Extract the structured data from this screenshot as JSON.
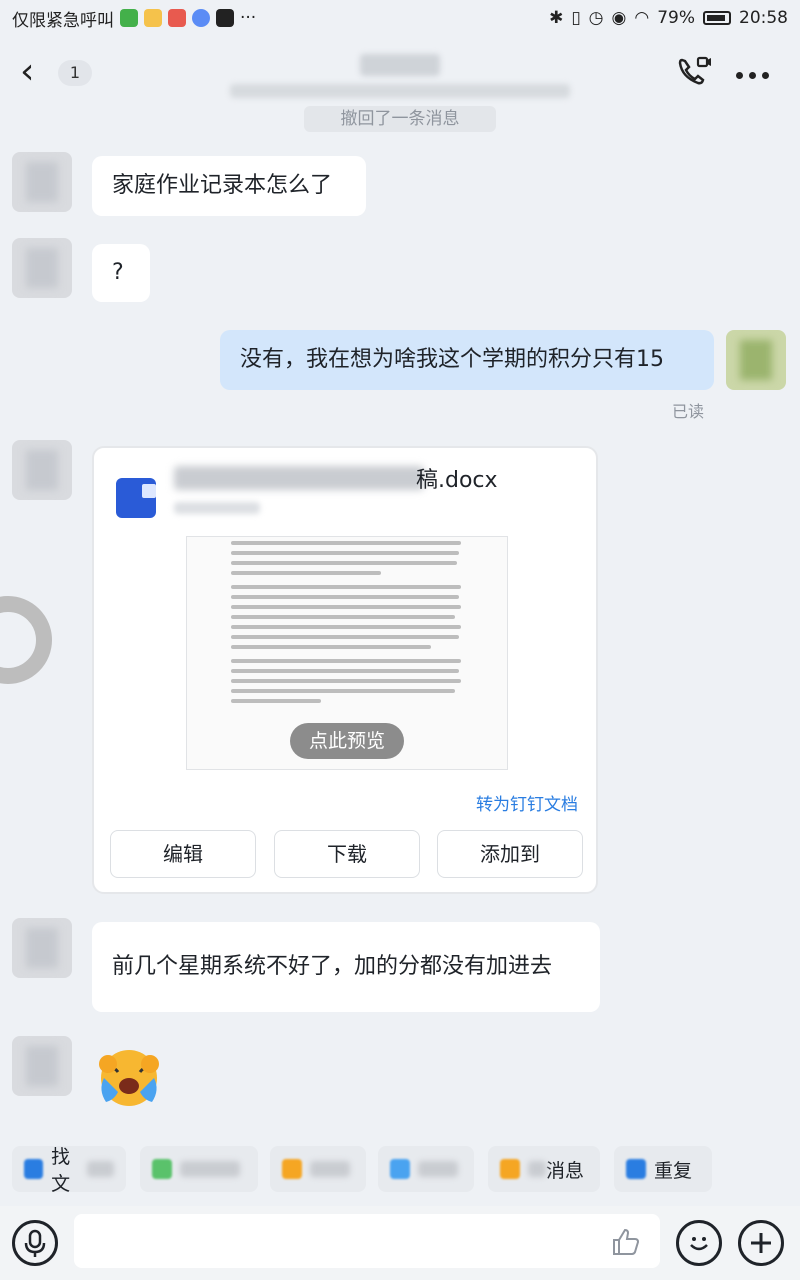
{
  "status_bar": {
    "carrier": "仅限紧急呼叫",
    "more": "···",
    "battery": "79%",
    "time": "20:58"
  },
  "header": {
    "unread_count": "1"
  },
  "system_note": "撤回了一条消息",
  "messages": [
    {
      "text": "家庭作业记录本怎么了"
    },
    {
      "text": "?"
    },
    {
      "text": "没有，我在想为啥我这个学期的积分只有15",
      "mine": true,
      "status": "已读"
    },
    {
      "text": "前几个星期系统不好了，加的分都没有加进去"
    }
  ],
  "file_card": {
    "filename_suffix": "稿.docx",
    "preview_button": "点此预览",
    "convert_link": "转为钉钉文档",
    "buttons": {
      "edit": "编辑",
      "download": "下载",
      "add_to": "添加到"
    }
  },
  "quick_actions": [
    {
      "label": "找文"
    },
    {
      "label": ""
    },
    {
      "label": ""
    },
    {
      "label": ""
    },
    {
      "label": "消息"
    },
    {
      "label": "重复"
    }
  ],
  "input": {
    "placeholder": ""
  }
}
